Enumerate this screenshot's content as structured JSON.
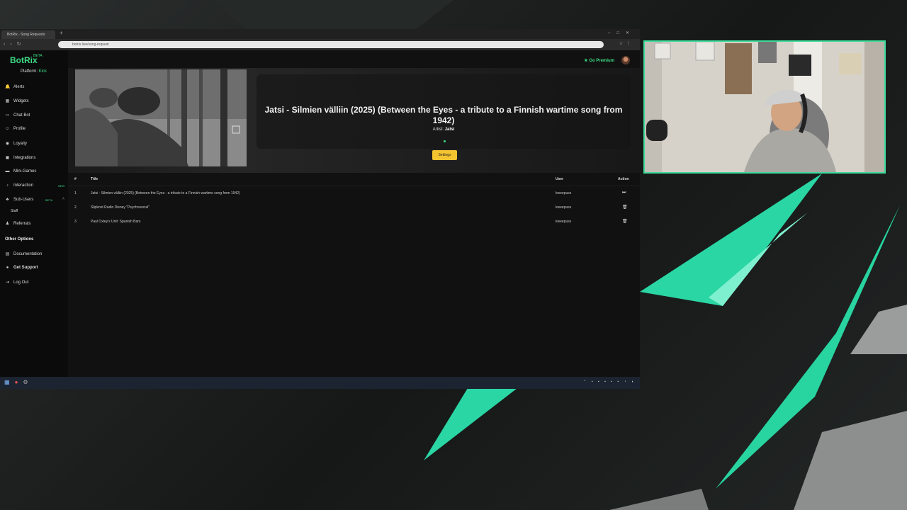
{
  "browser": {
    "tab_title": "BotRix - Song Requests",
    "url": "botrix.live/song-request"
  },
  "sidebar": {
    "logo": "BotRix",
    "beta": "BETA",
    "platform_label": "Platform:",
    "platform_value": "Kick",
    "items": [
      {
        "label": "Alerts",
        "icon": "bell-icon"
      },
      {
        "label": "Widgets",
        "icon": "widget-icon"
      },
      {
        "label": "Chat Bot",
        "icon": "chat-icon"
      },
      {
        "label": "Profile",
        "icon": "user-icon"
      },
      {
        "label": "Loyalty",
        "icon": "coin-icon"
      },
      {
        "label": "Integrations",
        "icon": "plug-icon"
      },
      {
        "label": "Mini-Games",
        "icon": "gamepad-icon"
      },
      {
        "label": "Interaction",
        "icon": "music-icon",
        "badge": "NEW"
      },
      {
        "label": "Sub-Users",
        "icon": "users-icon",
        "badge": "BETA"
      },
      {
        "label": "Staff",
        "icon": ""
      },
      {
        "label": "Referrals",
        "icon": "referral-icon"
      }
    ],
    "other_options_label": "Other Options",
    "other_items": [
      {
        "label": "Documentation",
        "icon": "doc-icon"
      },
      {
        "label": "Get Support",
        "icon": "support-icon"
      },
      {
        "label": "Log Out",
        "icon": "logout-icon"
      }
    ]
  },
  "header": {
    "premium_label": "Go Premium"
  },
  "now_playing": {
    "title": "Jatsi - Silmien välliin (2025) (Between the Eyes - a tribute to a Finnish wartime song from 1942)",
    "artist_label": "Artist:",
    "artist": "Jatsi",
    "settings_label": "Settings"
  },
  "queue": {
    "columns": {
      "num": "#",
      "title": "Title",
      "user": "User",
      "action": "Action"
    },
    "rows": [
      {
        "num": "1",
        "title": "Jatsi - Silmien välliin (2025) (Between the Eyes - a tribute to a Finnish wartime song from 1942)",
        "user": "kweepuss",
        "action": "skip-icon"
      },
      {
        "num": "2",
        "title": "Slipknot Radio Disney \"Psychosocial\"",
        "user": "kweepuss",
        "action": "trash-icon"
      },
      {
        "num": "3",
        "title": "Paul Oxley's Unit: Spanish Bars",
        "user": "kweepuss",
        "action": "trash-icon"
      }
    ]
  },
  "colors": {
    "accent": "#3ddc84",
    "settings": "#f4c430",
    "cam_border": "#3ddc9a"
  }
}
